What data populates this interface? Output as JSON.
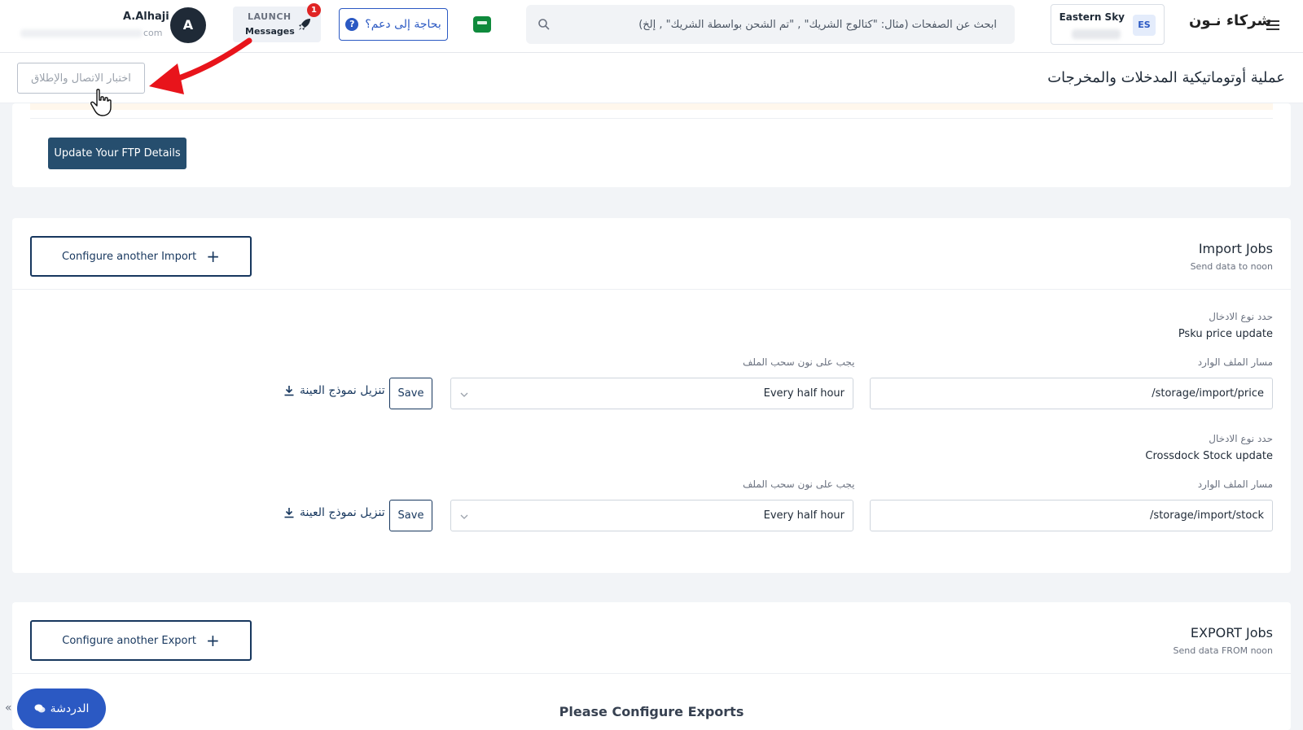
{
  "header": {
    "logo_text": "شركاء نـون",
    "store": {
      "badge": "ES",
      "name": "Eastern Sky"
    },
    "search": {
      "placeholder": "ابحث عن الصفحات (مثال: \"كتالوج الشريك\" , \"تم الشحن بواسطة الشريك\" , إلخ)"
    },
    "help_label": "بحاجة إلى دعم؟",
    "help_icon": "?",
    "launch": {
      "title": "LAUNCH",
      "subtitle": "Messages",
      "badge": "1"
    },
    "user": {
      "initial": "A",
      "name": "A.Alhaji",
      "email_suffix": "com"
    }
  },
  "subheader": {
    "title": "عملية أوتوماتيكية المدخلات والمخرجات",
    "test_button": "اختبار الاتصال والإطلاق"
  },
  "ftp": {
    "update_button": "Update Your FTP Details"
  },
  "import_jobs": {
    "title": "Import Jobs",
    "subtitle": "Send data to noon",
    "configure_button": "Configure another Import",
    "jobs": [
      {
        "type_label": "حدد نوع الادخال",
        "type_value": "Psku price update",
        "path_label": "مسار الملف الوارد",
        "path_value": "storage/import/price/",
        "frequency_label": "يجب على نون سحب الملف",
        "frequency_value": "Every half hour",
        "save_label": "Save",
        "download_label": "تنزيل نموذج العينة"
      },
      {
        "type_label": "حدد نوع الادخال",
        "type_value": "Crossdock Stock update",
        "path_label": "مسار الملف الوارد",
        "path_value": "storage/import/stock/",
        "frequency_label": "يجب على نون سحب الملف",
        "frequency_value": "Every half hour",
        "save_label": "Save",
        "download_label": "تنزيل نموذج العينة"
      }
    ]
  },
  "export_jobs": {
    "title": "EXPORT Jobs",
    "subtitle": "Send data FROM noon",
    "configure_button": "Configure another Export",
    "empty_message": "Please Configure Exports"
  },
  "chat": {
    "label": "الدردشة",
    "collapse": "«"
  },
  "colors": {
    "primary_blue": "#2b59c3",
    "navy": "#17375e",
    "ftp_button": "#264e6e",
    "annotation_red": "#e8141b",
    "badge_red": "#e02424"
  }
}
